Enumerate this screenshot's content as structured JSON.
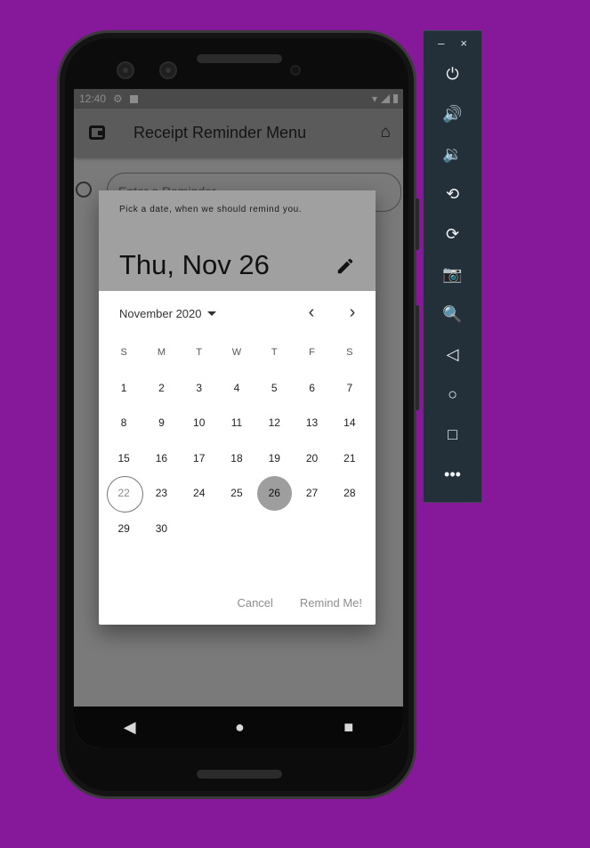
{
  "status_bar": {
    "time": "12:40"
  },
  "app_bar": {
    "title": "Receipt Reminder Menu"
  },
  "reminder_field": {
    "placeholder": "Enter a Reminder"
  },
  "dialog": {
    "help_text": "Pick a date, when we should remind you.",
    "selected_date_text": "Thu, Nov 26",
    "month_label": "November 2020",
    "weekdays": [
      "S",
      "M",
      "T",
      "W",
      "T",
      "F",
      "S"
    ],
    "weeks": [
      [
        "1",
        "2",
        "3",
        "4",
        "5",
        "6",
        "7"
      ],
      [
        "8",
        "9",
        "10",
        "11",
        "12",
        "13",
        "14"
      ],
      [
        "15",
        "16",
        "17",
        "18",
        "19",
        "20",
        "21"
      ],
      [
        "22",
        "23",
        "24",
        "25",
        "26",
        "27",
        "28"
      ],
      [
        "29",
        "30",
        "",
        "",
        "",
        "",
        ""
      ]
    ],
    "today": "22",
    "selected": "26",
    "cancel_label": "Cancel",
    "confirm_label": "Remind Me!"
  },
  "emulator_toolbar": {
    "minimize": "–",
    "close": "×",
    "buttons": [
      {
        "name": "power-icon",
        "glyph": "⏻"
      },
      {
        "name": "volume-up-icon",
        "glyph": "🔊"
      },
      {
        "name": "volume-down-icon",
        "glyph": "🔉"
      },
      {
        "name": "rotate-left-icon",
        "glyph": "⟲"
      },
      {
        "name": "rotate-right-icon",
        "glyph": "⟳"
      },
      {
        "name": "camera-icon",
        "glyph": "📷"
      },
      {
        "name": "zoom-icon",
        "glyph": "🔍"
      },
      {
        "name": "back-icon",
        "glyph": "◁"
      },
      {
        "name": "home-icon",
        "glyph": "○"
      },
      {
        "name": "overview-icon",
        "glyph": "□"
      },
      {
        "name": "more-icon",
        "glyph": "•••"
      }
    ]
  },
  "colors": {
    "background": "#86189a",
    "header": "#a0a0a0",
    "selected_circle": "#9e9e9e"
  }
}
